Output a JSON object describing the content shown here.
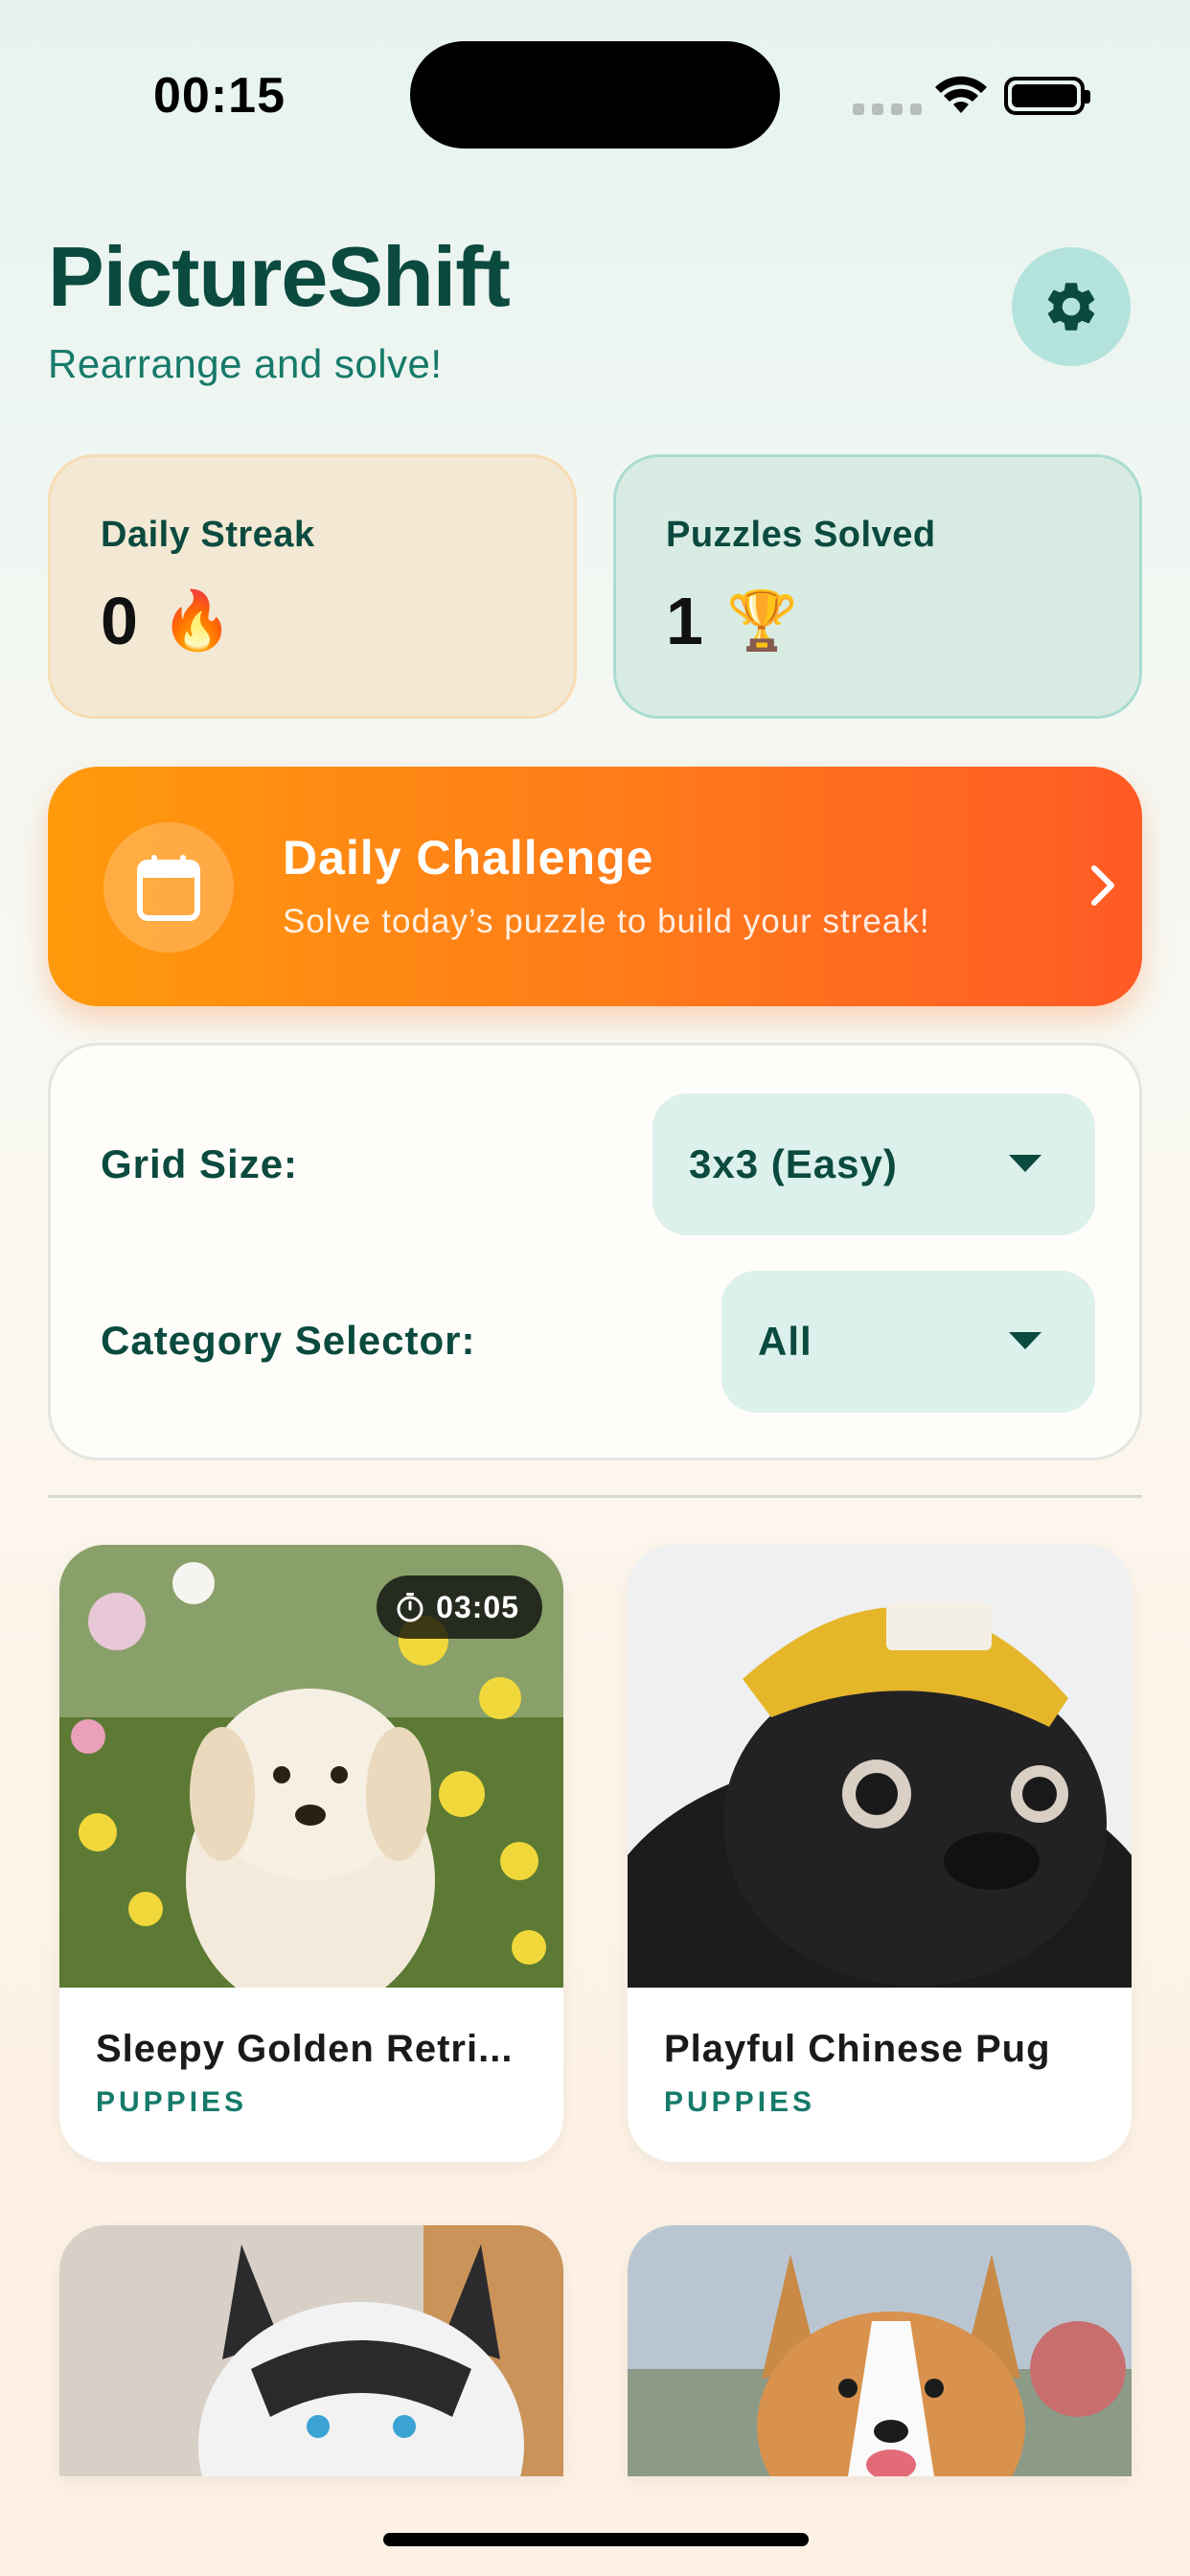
{
  "status_bar": {
    "time": "00:15"
  },
  "header": {
    "title": "PictureShift",
    "subtitle": "Rearrange and solve!",
    "settings_icon": "gear-icon"
  },
  "stats": {
    "streak": {
      "label": "Daily Streak",
      "value": "0",
      "emoji": "🔥"
    },
    "solved": {
      "label": "Puzzles Solved",
      "value": "1",
      "emoji": "🏆"
    }
  },
  "daily_challenge": {
    "title": "Daily Challenge",
    "subtitle": "Solve today’s puzzle to build your streak!",
    "icon": "calendar-icon"
  },
  "options": {
    "grid_label": "Grid Size:",
    "grid_value": "3x3 (Easy)",
    "category_label": "Category Selector:",
    "category_value": "All"
  },
  "puzzles": [
    {
      "title": "Sleepy Golden Retri...",
      "category": "PUPPIES",
      "timer": "03:05"
    },
    {
      "title": "Playful Chinese Pug",
      "category": "PUPPIES"
    },
    {
      "title": "",
      "category": ""
    },
    {
      "title": "",
      "category": ""
    }
  ],
  "colors": {
    "primary": "#0b4a3f",
    "accent_teal": "#167a6a",
    "challenge_start": "#ff9a0c",
    "challenge_end": "#ff5a25"
  }
}
